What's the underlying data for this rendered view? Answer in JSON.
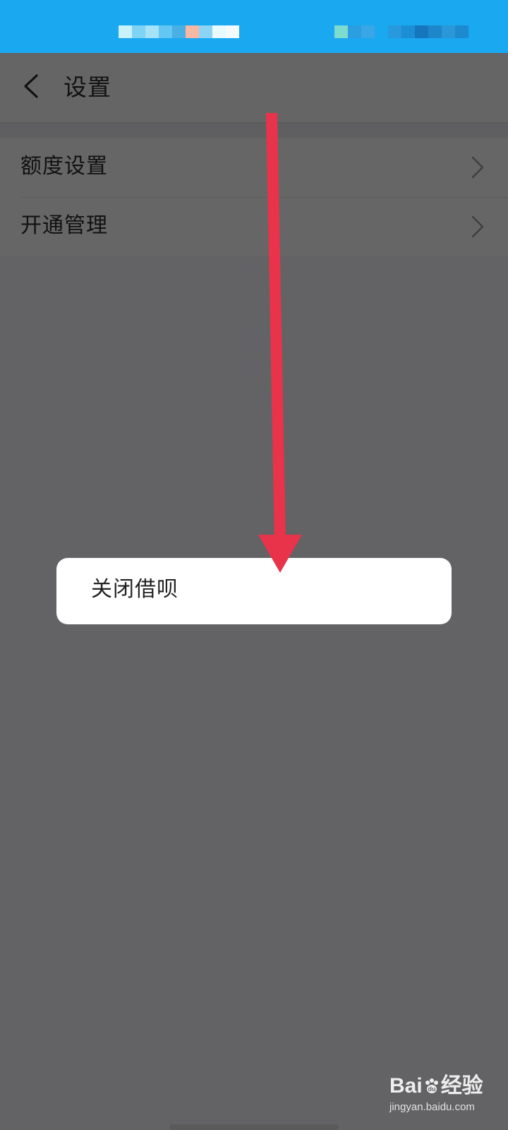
{
  "status_bar": {
    "color": "#1aa8f0",
    "mosaic_left_colors": [
      "#c9f2fb",
      "#7fd3f5",
      "#a6e2f8",
      "#63c6f3",
      "#49b0e4",
      "#f6b8a2",
      "#8bd4f6",
      "#eaf9fe",
      "#f4fbff"
    ],
    "mosaic_right_colors": [
      "#7edbd0",
      "#2a9ee0",
      "#3aa6e6",
      "#1aa8f0",
      "#2799dc",
      "#1c8ed6",
      "#1676bd",
      "#1e86cb",
      "#2a97d8",
      "#1d8ad0"
    ]
  },
  "header": {
    "back_icon": "chevron-left-icon",
    "title": "设置"
  },
  "settings_list": [
    {
      "label": "额度设置",
      "icon": "chevron-right-icon"
    },
    {
      "label": "开通管理",
      "icon": "chevron-right-icon"
    }
  ],
  "dialog": {
    "option_label": "关闭借呗"
  },
  "annotation": {
    "arrow_color": "#e8334a"
  },
  "watermark": {
    "brand": "Bai 经验",
    "brand_prefix": "Bai",
    "brand_suffix": "经验",
    "url": "jingyan.baidu.com"
  }
}
